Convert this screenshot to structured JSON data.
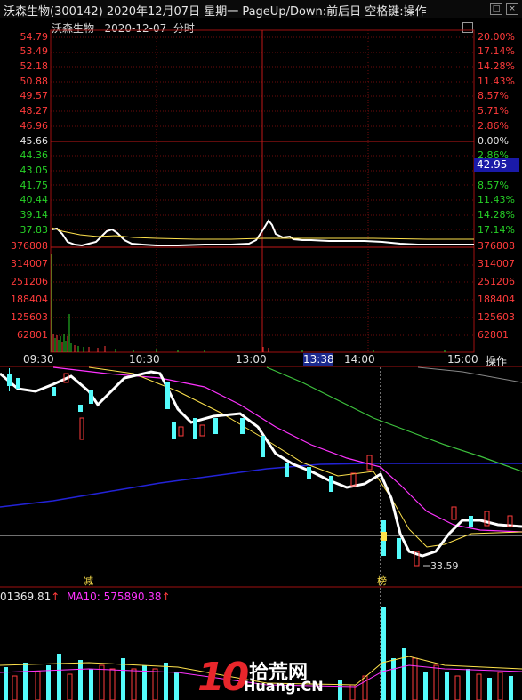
{
  "window": {
    "title": "沃森生物(300142) 2020年12月07日 星期一 PageUp/Down:前后日 空格键:操作",
    "btn_restore": "□",
    "btn_close": "×"
  },
  "intraday": {
    "stock_name": "沃森生物",
    "date": "2020-12-07",
    "mode": "分时",
    "base_price": "45.66",
    "price_labels": [
      "54.79",
      "53.49",
      "52.18",
      "50.88",
      "49.57",
      "48.27",
      "46.96",
      "45.66",
      "44.36",
      "43.05",
      "41.75",
      "40.44",
      "39.14",
      "37.83"
    ],
    "pct_labels": [
      "20.00%",
      "17.14%",
      "14.28%",
      "11.43%",
      "8.57%",
      "5.71%",
      "2.86%",
      "0.00%",
      "2.86%",
      "5.71%",
      "8.57%",
      "11.43%",
      "14.28%",
      "17.14%"
    ],
    "volume_labels_left": [
      "376808",
      "314007",
      "251206",
      "188404",
      "125603",
      "62801"
    ],
    "volume_labels_right": [
      "376808",
      "314007",
      "251206",
      "188404",
      "125603",
      "62801"
    ],
    "current_price": "42.95",
    "time_labels": [
      "09:30",
      "10:30",
      "13:00",
      "14:00",
      "15:00"
    ],
    "cursor_time": "13:38",
    "operate_button": "操作"
  },
  "kline": {
    "low_annotation": "33.59",
    "marker_left": "减",
    "marker_right": "榜"
  },
  "volume_panel": {
    "ma_label_1": "01369.81",
    "ma_label_2": "MA10: 575890.38",
    "arrow": "↑"
  },
  "watermark": {
    "number": "10",
    "cn": "拾荒网",
    "en": "Huang.CN"
  },
  "colors": {
    "up": "#ff3b3b",
    "down": "#27d127",
    "cyan": "#54fbfb",
    "ma_magenta": "#ff33ff",
    "ma_yellow": "#ffe34d",
    "ma_green": "#3ec43e",
    "ma_blue": "#2323d8"
  }
}
